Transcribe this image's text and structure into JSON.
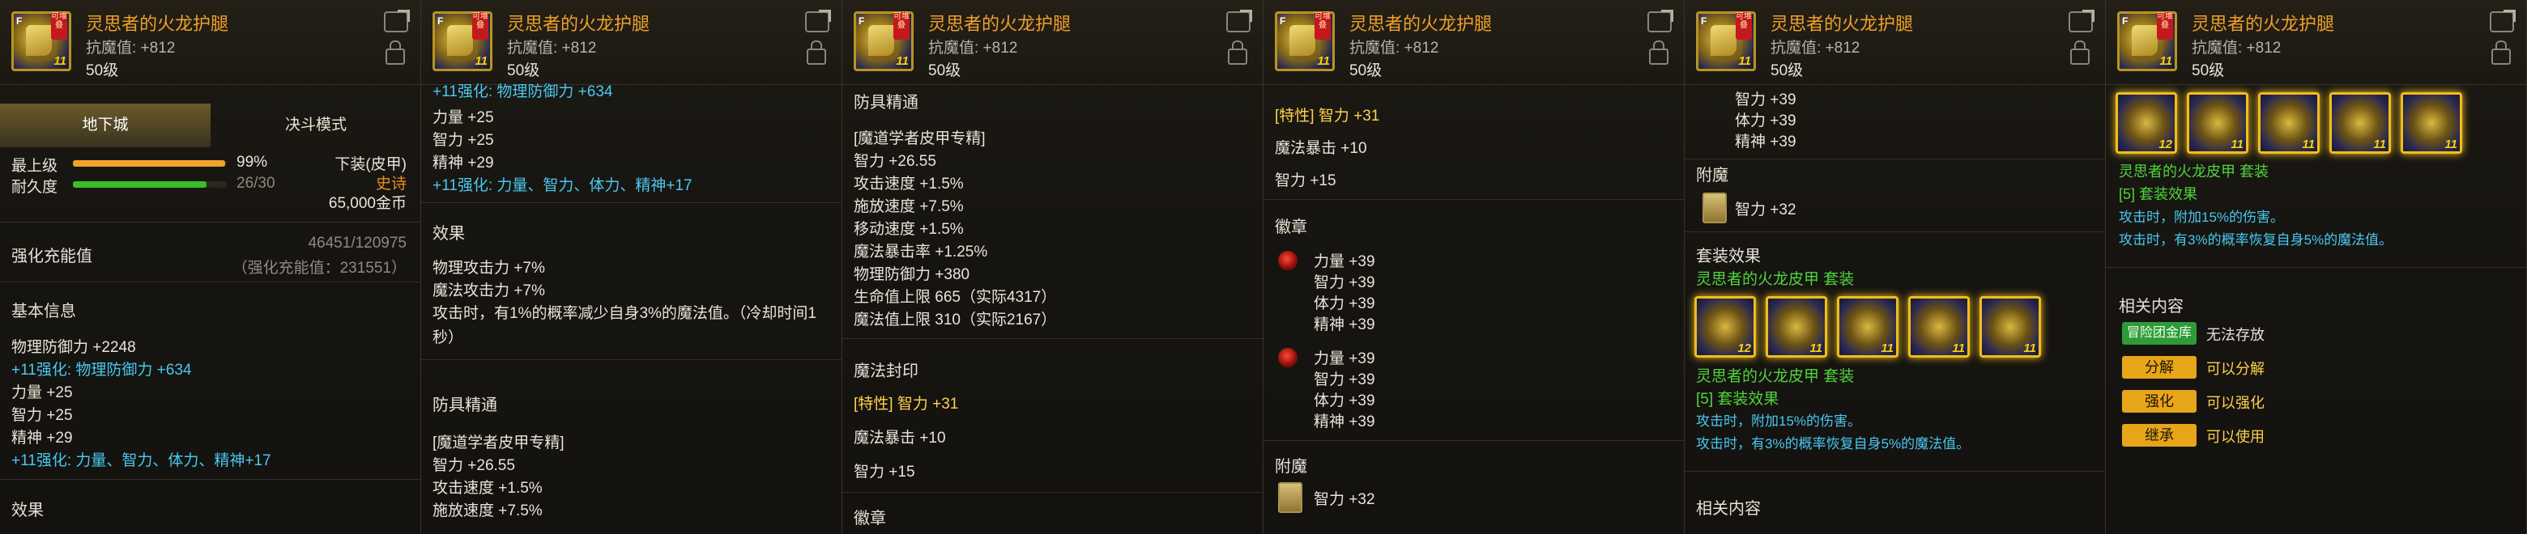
{
  "item": {
    "name": "灵思者的火龙护腿",
    "stat": "抗魔值: +812",
    "level": "50级",
    "tag": "可堆叠",
    "plus": "F",
    "ilvl": "11"
  },
  "p1": {
    "tab_dungeon": "地下城",
    "tab_duel": "决斗模式",
    "max_level_label": "最上级",
    "max_level_pct": "99%",
    "dur_label": "耐久度",
    "dur_val": "26/30",
    "slot": "下装(皮甲)",
    "rarity": "史诗",
    "price": "65,000金币",
    "reinf_label": "强化充能值",
    "reinf_val": "46451/120975",
    "reinf_sub": "（强化充能值：231551）",
    "basic_label": "基本信息",
    "lines": [
      "物理防御力 +2248",
      "+11强化: 物理防御力 +634",
      "力量 +25",
      "智力 +25",
      "精神 +29",
      "+11强化: 力量、智力、体力、精神+17"
    ],
    "effect_label": "效果",
    "colors": {
      "max_bar": "#f0a42a",
      "dur_bar": "#3bbd2a"
    }
  },
  "p2": {
    "top": "+11强化: 物理防御力 +634",
    "lines": [
      "力量 +25",
      "智力 +25",
      "精神 +29",
      "+11强化: 力量、智力、体力、精神+17"
    ],
    "effect_label": "效果",
    "effects": [
      "物理攻击力 +7%",
      "魔法攻击力 +7%",
      "攻击时，有1%的概率减少自身3%的魔法值。（冷却时间1",
      "秒）"
    ],
    "armor_label": "防具精通",
    "armor": [
      "[魔道学者皮甲专精]",
      "智力 +26.55",
      "攻击速度 +1.5%",
      "施放速度 +7.5%"
    ]
  },
  "p3": {
    "armor_label": "防具精通",
    "armor": [
      "[魔道学者皮甲专精]",
      "智力 +26.55",
      "攻击速度 +1.5%",
      "施放速度 +7.5%",
      "移动速度 +1.5%",
      "魔法暴击率 +1.25%",
      "物理防御力 +380",
      "生命值上限 665（实际4317）",
      "魔法值上限 310（实际2167）"
    ],
    "seal_label": "魔法封印",
    "seal": [
      "[特性] 智力 +31",
      "魔法暴击 +10",
      "智力 +15"
    ],
    "badge_label": "徽章"
  },
  "p4": {
    "seal": [
      "[特性] 智力 +31",
      "魔法暴击 +10",
      "智力 +15"
    ],
    "badge_label": "徽章",
    "badge1": [
      "力量 +39",
      "智力 +39",
      "体力 +39",
      "精神 +39"
    ],
    "badge2": [
      "力量 +39",
      "智力 +39",
      "体力 +39",
      "精神 +39"
    ],
    "ench_label": "附魔",
    "ench": "智力 +32"
  },
  "p5": {
    "top": [
      "智力 +39",
      "体力 +39",
      "精神 +39"
    ],
    "ench_label": "附魔",
    "ench": "智力 +32",
    "set_label": "套装效果",
    "set_name": "灵思者的火龙皮甲",
    "set_suffix": "套装",
    "set_count": "[5] 套装效果",
    "set_effects": [
      "攻击时，附加15%的伤害。",
      "攻击时，有3%的概率恢复自身5%的魔法值。"
    ],
    "related_label": "相关内容"
  },
  "p6": {
    "set_name": "灵思者的火龙皮甲",
    "set_suffix": "套装",
    "set_count": "[5] 套装效果",
    "set_effects": [
      "攻击时，附加15%的伤害。",
      "攻击时，有3%的概率恢复自身5%的魔法值。"
    ],
    "related_label": "相关内容",
    "actions": [
      {
        "btn": "冒险团金库",
        "text": "无法存放"
      },
      {
        "btn": "分解",
        "text": "可以分解"
      },
      {
        "btn": "强化",
        "text": "可以强化"
      },
      {
        "btn": "继承",
        "text": "可以使用"
      }
    ]
  }
}
